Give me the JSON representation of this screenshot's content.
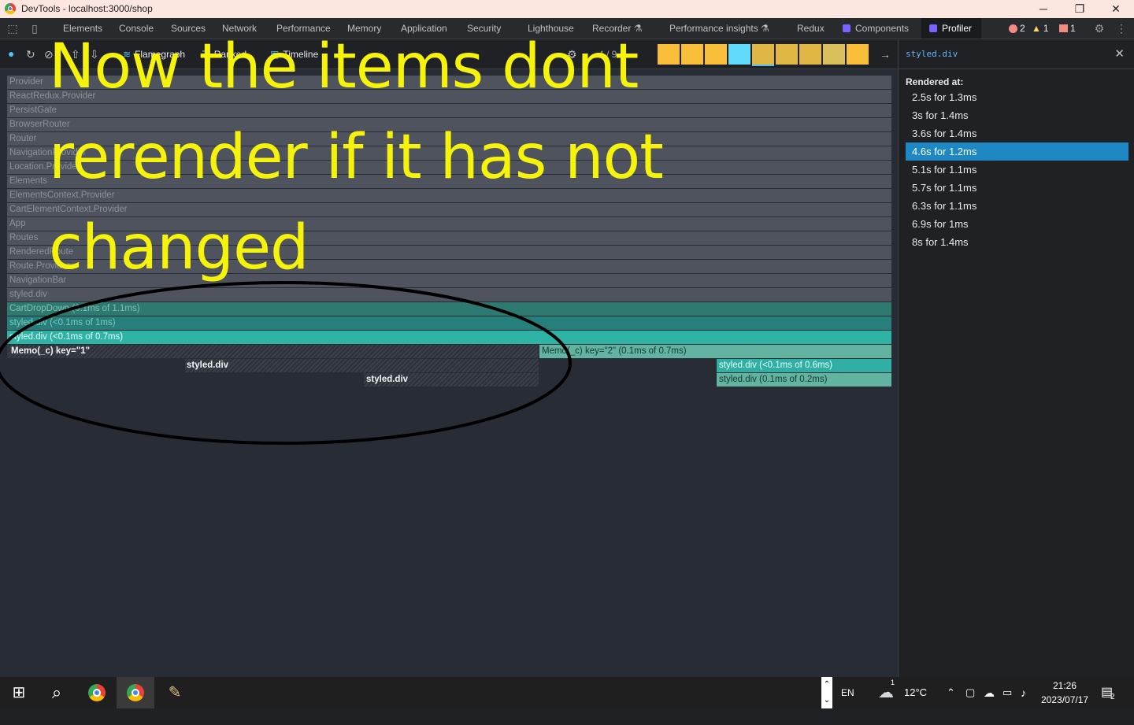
{
  "window": {
    "title": "DevTools - localhost:3000/shop",
    "controls": {
      "minimize": "─",
      "restore": "❐",
      "close": "✕"
    }
  },
  "tabs": [
    {
      "label": "Elements"
    },
    {
      "label": "Console"
    },
    {
      "label": "Sources"
    },
    {
      "label": "Network"
    },
    {
      "label": "Performance"
    },
    {
      "label": "Memory"
    },
    {
      "label": "Application"
    },
    {
      "label": "Security"
    },
    {
      "label": "Lighthouse"
    },
    {
      "label": "Recorder ⚗"
    },
    {
      "label": "Performance insights ⚗"
    },
    {
      "label": "Redux"
    },
    {
      "label": "Components"
    },
    {
      "label": "Profiler"
    }
  ],
  "badges": {
    "errors": "2",
    "warnings": "1",
    "issues": "1"
  },
  "toolbar": {
    "flamegraph": "Flamegraph",
    "ranked": "Ranked",
    "timeline": "Timeline",
    "commit_counter": "4 / 9",
    "commit_colors": [
      "#f9bf3b",
      "#f9bf3b",
      "#f9bf3b",
      "#61dafb",
      "#e0b645",
      "#e0b645",
      "#e0b645",
      "#d9c05c",
      "#f9bf3b"
    ],
    "selected_commit": 4
  },
  "flame_rows": [
    {
      "label": "Provider",
      "style": "gray"
    },
    {
      "label": "ReactRedux.Provider",
      "style": "gray"
    },
    {
      "label": "PersistGate",
      "style": "gray"
    },
    {
      "label": "BrowserRouter",
      "style": "gray"
    },
    {
      "label": "Router",
      "style": "gray"
    },
    {
      "label": "NavigationProvider",
      "style": "gray"
    },
    {
      "label": "Location.Provider",
      "style": "gray"
    },
    {
      "label": "Elements",
      "style": "gray"
    },
    {
      "label": "ElementsContext.Provider",
      "style": "gray"
    },
    {
      "label": "CartElementContext.Provider",
      "style": "gray"
    },
    {
      "label": "App",
      "style": "gray"
    },
    {
      "label": "Routes",
      "style": "gray"
    },
    {
      "label": "RenderedRoute",
      "style": "gray"
    },
    {
      "label": "Route.Provider",
      "style": "gray"
    },
    {
      "label": "NavigationBar",
      "style": "gray"
    },
    {
      "label": "styled.div",
      "style": "gray"
    },
    {
      "label": "CartDropDown (0.1ms of 1.1ms)",
      "style": "teal1"
    },
    {
      "label": "styled.div (<0.1ms of 1ms)",
      "style": "teal2"
    },
    {
      "label": "styled.div (<0.1ms of 0.7ms)",
      "style": "teal3"
    }
  ],
  "flame_children": [
    {
      "label": "Memo(_c) key=\"1\"",
      "style": "hatch"
    },
    {
      "label": "Memo(_c) key=\"2\" (0.1ms of 0.7ms)",
      "style": "teal4"
    },
    {
      "label": "styled.div",
      "style": "hatch"
    },
    {
      "label": "styled.div (<0.1ms of 0.6ms)",
      "style": "teal5"
    },
    {
      "label": "styled.div",
      "style": "hatch"
    },
    {
      "label": "styled.div (0.1ms of 0.2ms)",
      "style": "teal4"
    }
  ],
  "sidebar": {
    "title": "styled.div",
    "rendered_label": "Rendered at:",
    "renders": [
      {
        "label": "2.5s for 1.3ms"
      },
      {
        "label": "3s for 1.4ms"
      },
      {
        "label": "3.6s for 1.4ms"
      },
      {
        "label": "4.6s for 1.2ms"
      },
      {
        "label": "5.1s for 1.1ms"
      },
      {
        "label": "5.7s for 1.1ms"
      },
      {
        "label": "6.3s for 1.1ms"
      },
      {
        "label": "6.9s for 1ms"
      },
      {
        "label": "8s for 1.4ms"
      }
    ],
    "selected_index": 3
  },
  "annotation": {
    "lines": [
      "Now the items dont",
      "rerender if it has not",
      "changed"
    ],
    "color": "#f5f20c"
  },
  "taskbar": {
    "language": "EN",
    "temperature": "12°C",
    "time": "21:26",
    "date": "2023/07/17",
    "notifications": "2",
    "weather_badge": "1"
  }
}
